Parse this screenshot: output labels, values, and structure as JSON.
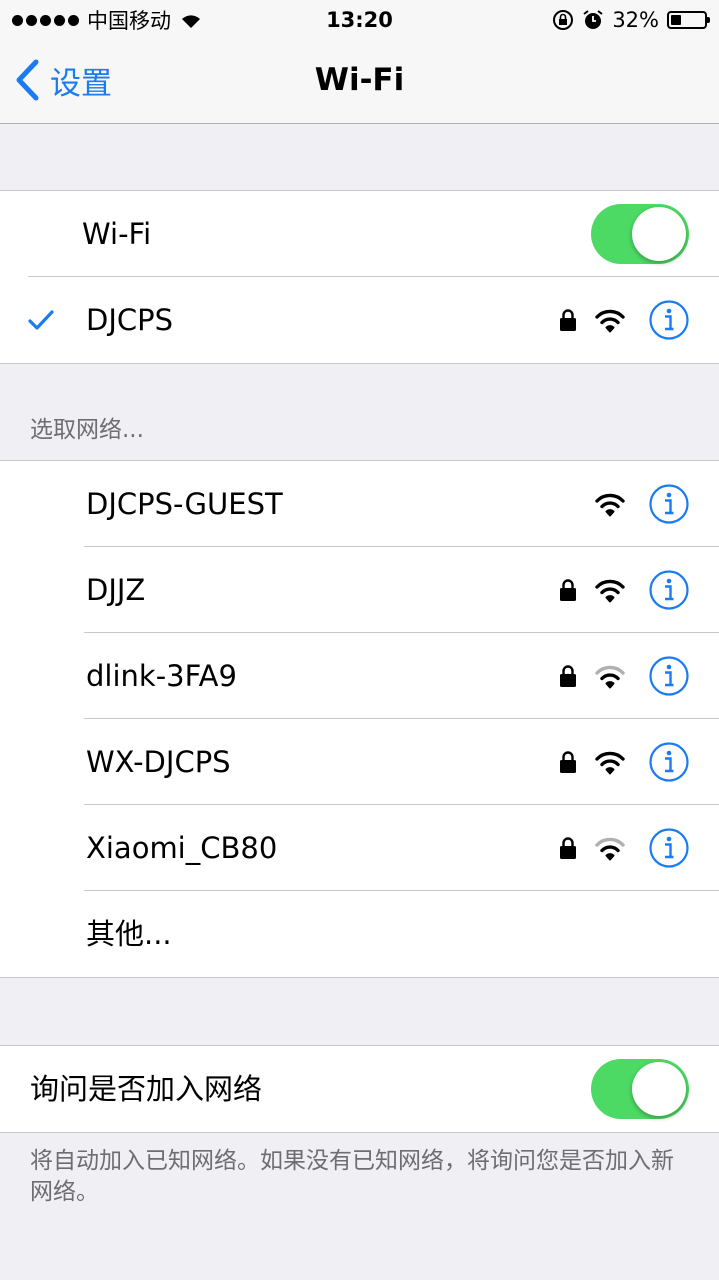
{
  "status_bar": {
    "carrier": "中国移动",
    "time": "13:20",
    "battery_percent": "32%",
    "battery_level": 0.32,
    "icons": [
      "signal-dots-icon",
      "wifi-icon",
      "orientation-lock-icon",
      "alarm-icon",
      "battery-icon"
    ]
  },
  "nav": {
    "back_label": "设置",
    "title": "Wi-Fi"
  },
  "wifi_toggle": {
    "label": "Wi-Fi",
    "on": true
  },
  "connected": {
    "name": "DJCPS",
    "locked": true,
    "signal": "full"
  },
  "networks_header": "选取网络...",
  "networks": [
    {
      "name": "DJCPS-GUEST",
      "locked": false,
      "signal": "full"
    },
    {
      "name": "DJJZ",
      "locked": true,
      "signal": "full"
    },
    {
      "name": "dlink-3FA9",
      "locked": true,
      "signal": "weak"
    },
    {
      "name": "WX-DJCPS",
      "locked": true,
      "signal": "full"
    },
    {
      "name": "Xiaomi_CB80",
      "locked": true,
      "signal": "weak"
    }
  ],
  "other_label": "其他...",
  "ask_join": {
    "label": "询问是否加入网络",
    "on": true
  },
  "footer_note": "将自动加入已知网络。如果没有已知网络，将询问您是否加入新网络。",
  "colors": {
    "accent": "#1a7bf2",
    "toggle_on": "#4cd964",
    "background": "#efeff4"
  }
}
